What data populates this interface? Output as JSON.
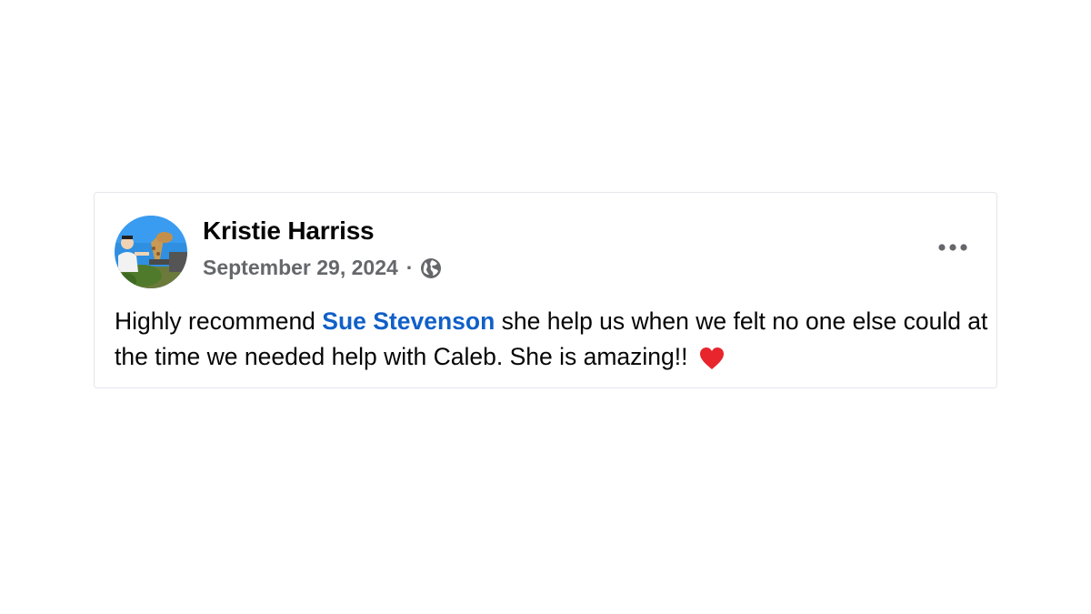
{
  "post": {
    "author_name": "Kristie Harriss",
    "date": "September 29, 2024",
    "separator": "·",
    "audience_icon": "globe-icon",
    "more_icon": "more-horizontal-icon",
    "text_before_mention": "Highly recommend ",
    "mention": "Sue Stevenson",
    "text_after_mention": " she help us when we felt no one else could at the time we needed help with Caleb. She is amazing!!",
    "emoji": "red-heart-icon"
  },
  "colors": {
    "mention_link": "#1160c8",
    "meta_text": "#65676b",
    "heart": "#e8242c",
    "card_border": "#e4e6eb"
  }
}
